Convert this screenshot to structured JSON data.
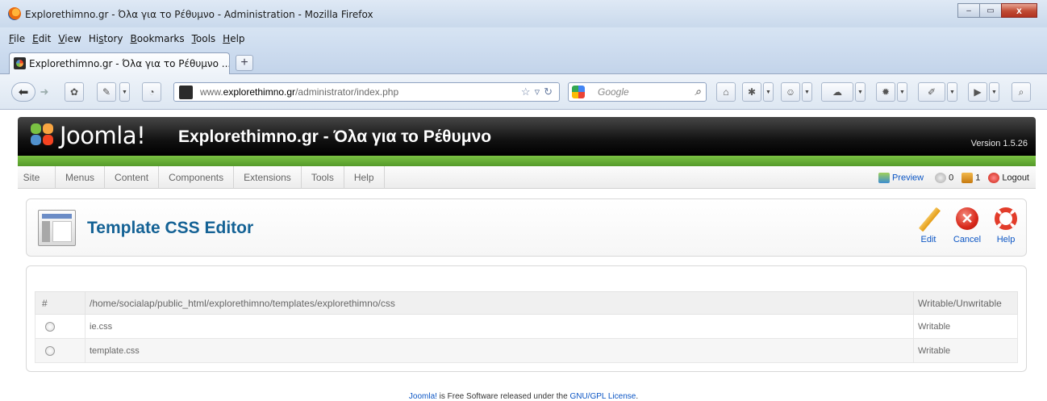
{
  "browser": {
    "window_title": "Explorethimno.gr - Όλα για το Ρέθυμνο - Administration - Mozilla Firefox",
    "menu": [
      "File",
      "Edit",
      "View",
      "History",
      "Bookmarks",
      "Tools",
      "Help"
    ],
    "menu_access_keys": [
      "F",
      "E",
      "V",
      "s",
      "B",
      "T",
      "H"
    ],
    "tab_title": "Explorethimno.gr - Όλα για το Ρέθυμνο ...",
    "newtab_label": "+",
    "url_prefix": "www.",
    "url_host": "explorethimno.gr",
    "url_path": "/administrator/index.php",
    "search_placeholder": "Google",
    "window_buttons": {
      "minimize": "–",
      "maximize": "▭",
      "close": "x"
    }
  },
  "joomla": {
    "logo_text": "Joomla!",
    "site_title": "Explorethimno.gr - Όλα για το Ρέθυμνο",
    "version": "Version 1.5.26",
    "menu": [
      "Site",
      "Menus",
      "Content",
      "Components",
      "Extensions",
      "Tools",
      "Help"
    ],
    "status": {
      "preview": "Preview",
      "messages": "0",
      "users": "1",
      "logout": "Logout"
    },
    "page_title": "Template CSS Editor",
    "toolbar": {
      "edit": "Edit",
      "cancel": "Cancel",
      "help": "Help"
    },
    "table": {
      "col_num": "#",
      "col_path": "/home/socialap/public_html/explorethimno/templates/explorethimno/css",
      "col_status": "Writable/Unwritable",
      "rows": [
        {
          "file": "ie.css",
          "status": "Writable"
        },
        {
          "file": "template.css",
          "status": "Writable"
        }
      ]
    },
    "footer": {
      "link1": "Joomla!",
      "text": " is Free Software released under the ",
      "link2": "GNU/GPL License",
      "end": "."
    }
  },
  "colors": {
    "joomla_green": "#7ac143",
    "title_blue": "#146295",
    "link_blue": "#0b55c4",
    "writable_green": "#339933"
  }
}
